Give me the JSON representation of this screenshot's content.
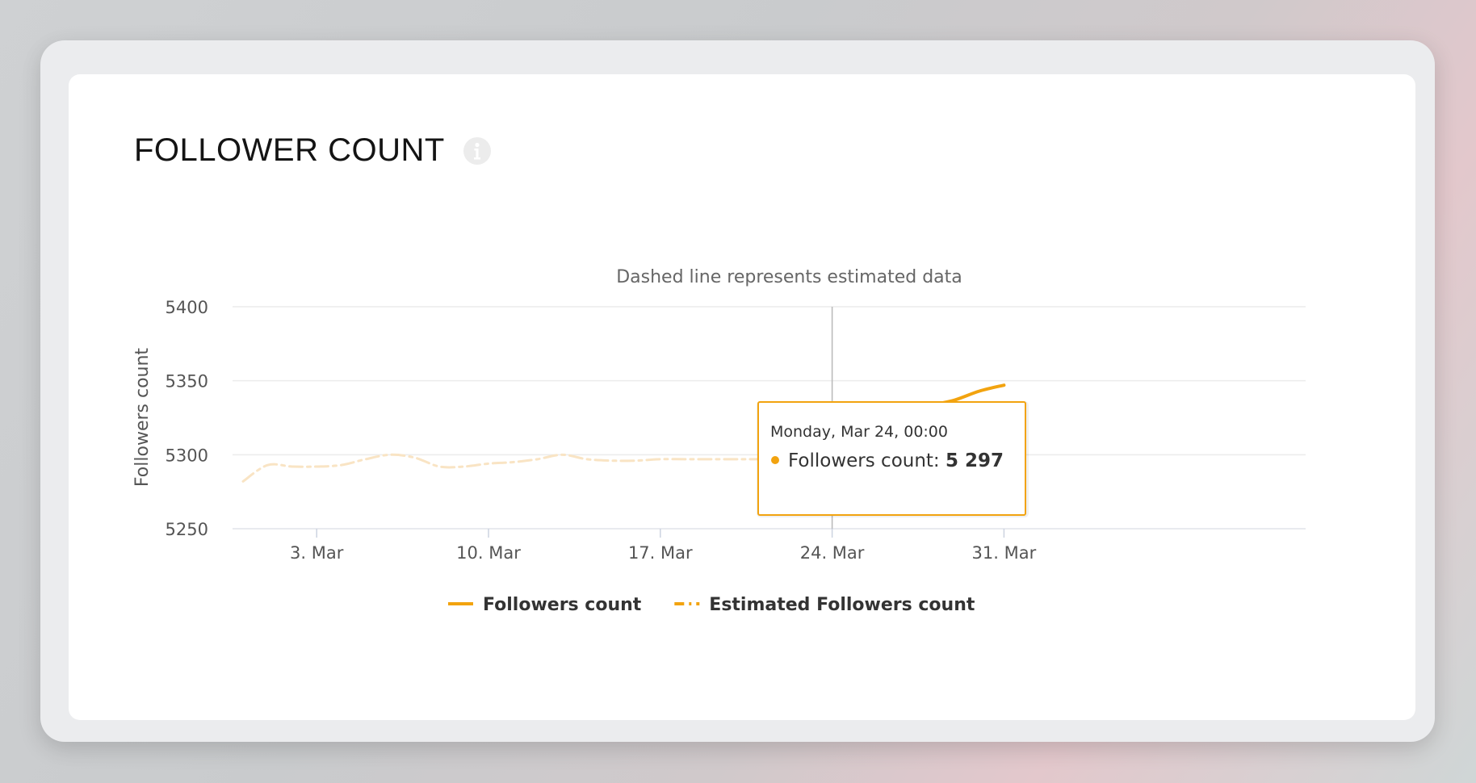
{
  "page": {
    "title": "FOLLOWER COUNT",
    "info_icon": "info-circle-icon"
  },
  "colors": {
    "series_main": "#f2a30f",
    "series_estimated": "#f9e4c4",
    "tooltip_border": "#f2a30f",
    "grid": "#ececec"
  },
  "chart_data": {
    "type": "line",
    "subtitle": "Dashed line represents estimated data",
    "ylabel": "Followers count",
    "ylim": [
      5250,
      5400
    ],
    "y_ticks": [
      5250,
      5300,
      5350,
      5400
    ],
    "x_range": [
      "2025-02-28",
      "2025-03-31"
    ],
    "x_ticks": [
      {
        "date": "2025-03-03",
        "label": "3. Mar"
      },
      {
        "date": "2025-03-10",
        "label": "10. Mar"
      },
      {
        "date": "2025-03-17",
        "label": "17. Mar"
      },
      {
        "date": "2025-03-24",
        "label": "24. Mar"
      },
      {
        "date": "2025-03-31",
        "label": "31. Mar"
      }
    ],
    "grid": true,
    "legend_position": "bottom",
    "series": [
      {
        "name": "Followers count",
        "style": "solid",
        "points": [
          [
            "2025-03-24",
            5297
          ],
          [
            "2025-03-25",
            5296
          ],
          [
            "2025-03-26",
            5320
          ],
          [
            "2025-03-27",
            5326
          ],
          [
            "2025-03-28",
            5333
          ],
          [
            "2025-03-29",
            5337
          ],
          [
            "2025-03-30",
            5343
          ],
          [
            "2025-03-31",
            5347
          ]
        ]
      },
      {
        "name": "Estimated Followers count",
        "style": "dashed",
        "points": [
          [
            "2025-02-28",
            5282
          ],
          [
            "2025-03-01",
            5293
          ],
          [
            "2025-03-02",
            5292
          ],
          [
            "2025-03-03",
            5292
          ],
          [
            "2025-03-04",
            5293
          ],
          [
            "2025-03-05",
            5297
          ],
          [
            "2025-03-06",
            5300
          ],
          [
            "2025-03-07",
            5298
          ],
          [
            "2025-03-08",
            5292
          ],
          [
            "2025-03-09",
            5292
          ],
          [
            "2025-03-10",
            5294
          ],
          [
            "2025-03-11",
            5295
          ],
          [
            "2025-03-12",
            5297
          ],
          [
            "2025-03-13",
            5300
          ],
          [
            "2025-03-14",
            5297
          ],
          [
            "2025-03-15",
            5296
          ],
          [
            "2025-03-16",
            5296
          ],
          [
            "2025-03-17",
            5297
          ],
          [
            "2025-03-18",
            5297
          ],
          [
            "2025-03-19",
            5297
          ],
          [
            "2025-03-20",
            5297
          ],
          [
            "2025-03-21",
            5297
          ],
          [
            "2025-03-22",
            5297
          ],
          [
            "2025-03-23",
            5297
          ],
          [
            "2025-03-24",
            5297
          ]
        ]
      }
    ],
    "tooltip": {
      "date": "2025-03-24",
      "header": "Monday, Mar 24, 00:00",
      "series_label": "Followers count",
      "value_text": "5 297",
      "value": 5297
    }
  }
}
